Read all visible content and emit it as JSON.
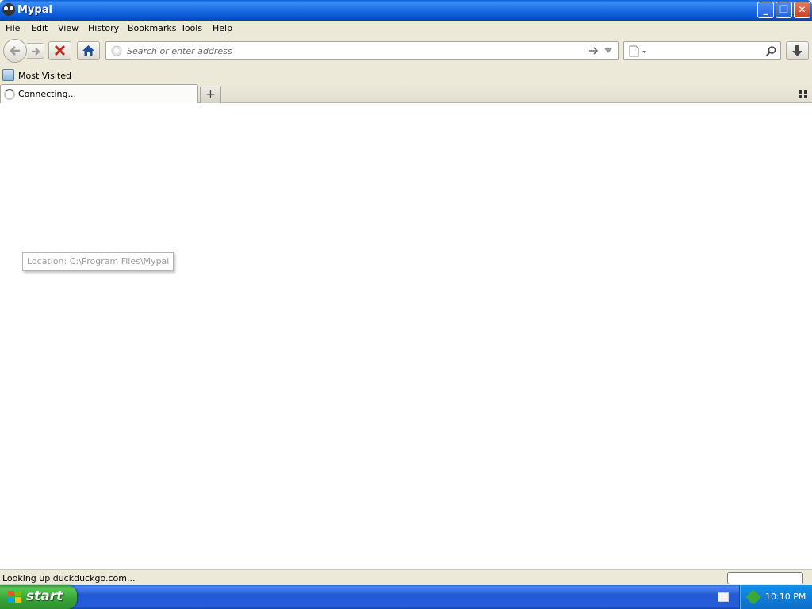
{
  "window": {
    "title": "Mypal"
  },
  "window_controls": {
    "minimize": "_",
    "maximize": "❐",
    "close": "✕"
  },
  "menu": {
    "items": [
      "File",
      "Edit",
      "View",
      "History",
      "Bookmarks",
      "Tools",
      "Help"
    ]
  },
  "navbar": {
    "url_placeholder": "Search or enter address",
    "search_value": ""
  },
  "bookmarks": {
    "items": [
      {
        "label": "Most Visited",
        "icon": "folder-icon"
      }
    ]
  },
  "tabs": [
    {
      "label": "Connecting...",
      "loading": true
    }
  ],
  "new_tab_symbol": "+",
  "tooltip": {
    "text": "Location: C:\\Program Files\\Mypal"
  },
  "status": {
    "text": "Looking up duckduckgo.com..."
  },
  "taskbar": {
    "start_label": "start",
    "clock": "10:10 PM"
  },
  "colors": {
    "titlebar": "#0654d0",
    "chrome": "#ece9d8",
    "taskbar": "#245edb",
    "start": "#3aa63a"
  }
}
